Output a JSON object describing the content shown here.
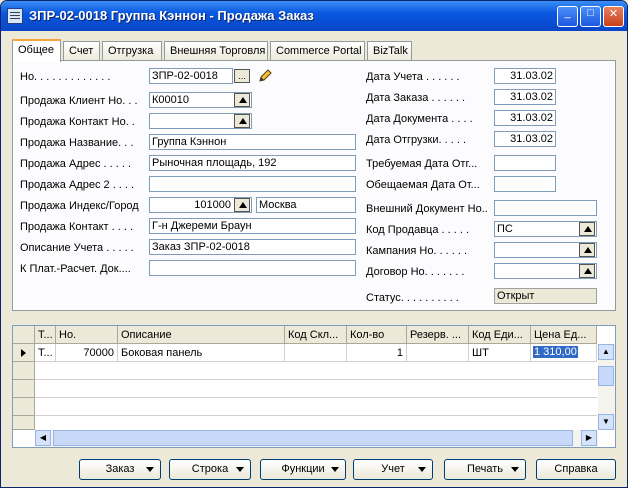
{
  "window": {
    "title": "ЗПР-02-0018 Группа Кэннон - Продажа Заказ",
    "min": "_",
    "max": "□",
    "close": "✕"
  },
  "tabs": [
    "Общее",
    "Счет",
    "Отгрузка",
    "Внешняя Торговля",
    "Commerce Portal",
    "BizTalk"
  ],
  "left": {
    "no_label": "Но. . . . . . . . . . . . .",
    "no_value": "ЗПР-02-0018",
    "assist": "...",
    "cust_no_label": "Продажа Клиент Но. . .",
    "cust_no_value": "К00010",
    "contact_no_label": "Продажа Контакт Но. .",
    "contact_no_value": "",
    "name_label": "Продажа Название. . .",
    "name_value": "Группа Кэннон",
    "address_label": "Продажа Адрес . . . . .",
    "address_value": "Рыночная площадь, 192",
    "address2_label": "Продажа Адрес 2 . . . .",
    "address2_value": "",
    "postcode_label": "Продажа Индекс/Город",
    "postcode_value": "101000",
    "city_value": "Москва",
    "contact_label": "Продажа Контакт . . . .",
    "contact_value": "Г-н Джереми Браун",
    "posting_desc_label": "Описание Учета . . . . .",
    "posting_desc_value": "Заказ ЗПР-02-0018",
    "payment_label": "К Плат.-Расчет. Док....",
    "payment_value": ""
  },
  "right": {
    "posting_date_label": "Дата Учета . . . . . .",
    "posting_date": "31.03.02",
    "order_date_label": "Дата Заказа . . . . . .",
    "order_date": "31.03.02",
    "doc_date_label": "Дата Документа . . . .",
    "doc_date": "31.03.02",
    "ship_date_label": "Дата Отгрузки. . . . .",
    "ship_date": "31.03.02",
    "req_date_label": "Требуемая Дата Отг...",
    "req_date": "",
    "prom_date_label": "Обещаемая Дата От...",
    "prom_date": "",
    "ext_doc_label": "Внешний Документ Но..",
    "ext_doc": "",
    "salesperson_label": "Код Продавца . . . . .",
    "salesperson": "ПС",
    "campaign_label": "Кампания Но. . . . . .",
    "campaign": "",
    "contract_label": "Договор Но. . . . . . .",
    "contract": "",
    "status_label": "Статус. . . . . . . . . .",
    "status": "Открыт"
  },
  "lines": {
    "headers": [
      "Т...",
      "Но.",
      "Описание",
      "Код Скл...",
      "Кол-во",
      "Резерв. ...",
      "Код Еди...",
      "Цена Ед..."
    ],
    "rows": [
      [
        "Т...",
        "70000",
        "Боковая панель",
        "",
        "1",
        "",
        "ШТ",
        "1 310,00"
      ]
    ]
  },
  "buttons": {
    "order": "Заказ",
    "line": "Строка",
    "functions": "Функции",
    "invoice": "Учет",
    "print": "Печать",
    "help": "Справка"
  }
}
